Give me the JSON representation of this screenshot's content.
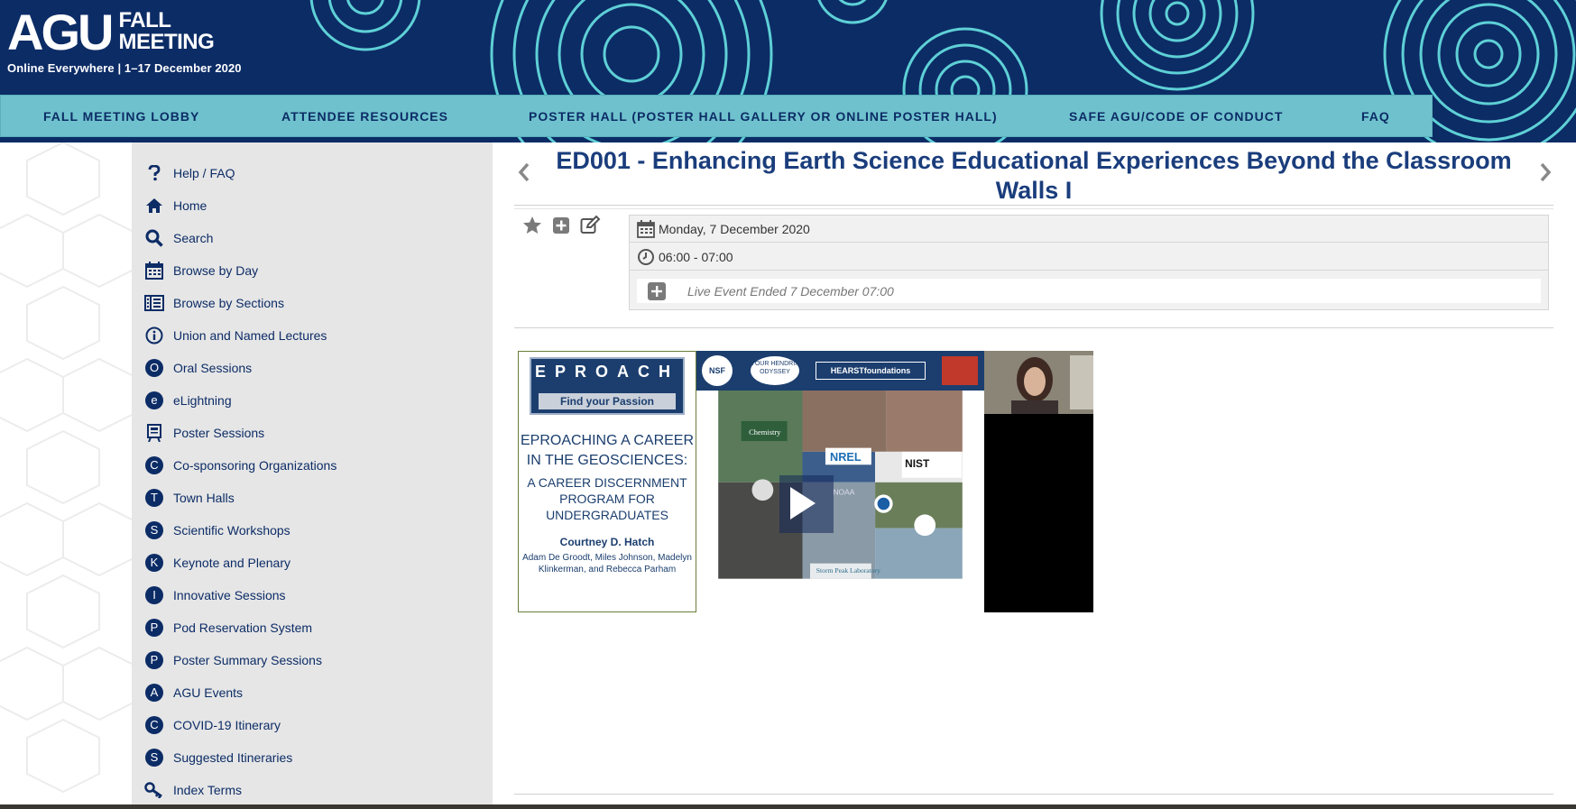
{
  "header": {
    "logo_agu": "AGU",
    "logo_line1": "FALL",
    "logo_line2": "MEETING",
    "tagline": "Online Everywhere  |  1–17 December 2020",
    "colors": {
      "banner": "#0c2c66",
      "nav": "#6fc2cd",
      "rings": "#5ed0d6"
    }
  },
  "topnav": [
    {
      "label": "FALL MEETING LOBBY"
    },
    {
      "label": "ATTENDEE RESOURCES"
    },
    {
      "label": "POSTER HALL (POSTER HALL GALLERY OR ONLINE POSTER HALL)"
    },
    {
      "label": "SAFE AGU/CODE OF CONDUCT"
    },
    {
      "label": "FAQ"
    }
  ],
  "sidebar": {
    "items": [
      {
        "label": "Help / FAQ",
        "icon": "question-icon"
      },
      {
        "label": "Home",
        "icon": "home-icon"
      },
      {
        "label": "Search",
        "icon": "search-icon"
      },
      {
        "label": "Browse by Day",
        "icon": "calendar-icon"
      },
      {
        "label": "Browse by Sections",
        "icon": "sections-icon"
      },
      {
        "label": "Union and Named Lectures",
        "icon": "info-icon"
      },
      {
        "label": "Oral Sessions",
        "icon": "letter-o-icon",
        "letter": "O"
      },
      {
        "label": "eLightning",
        "icon": "letter-e-icon",
        "letter": "e"
      },
      {
        "label": "Poster Sessions",
        "icon": "poster-icon"
      },
      {
        "label": "Co-sponsoring Organizations",
        "icon": "letter-c-icon",
        "letter": "C"
      },
      {
        "label": "Town Halls",
        "icon": "letter-t-icon",
        "letter": "T"
      },
      {
        "label": "Scientific Workshops",
        "icon": "letter-s-icon",
        "letter": "S"
      },
      {
        "label": "Keynote and Plenary",
        "icon": "letter-k-icon",
        "letter": "K"
      },
      {
        "label": "Innovative Sessions",
        "icon": "letter-i-icon",
        "letter": "I"
      },
      {
        "label": "Pod Reservation System",
        "icon": "letter-p-icon",
        "letter": "P"
      },
      {
        "label": "Poster Summary Sessions",
        "icon": "letter-p-icon",
        "letter": "P"
      },
      {
        "label": "AGU Events",
        "icon": "letter-a-icon",
        "letter": "A"
      },
      {
        "label": "COVID-19 Itinerary",
        "icon": "letter-c-icon",
        "letter": "C"
      },
      {
        "label": "Suggested Itineraries",
        "icon": "letter-s-icon",
        "letter": "S"
      },
      {
        "label": "Index Terms",
        "icon": "key-icon"
      }
    ]
  },
  "session": {
    "title": "ED001 - Enhancing Earth Science Educational Experiences Beyond the Classroom Walls I",
    "date": "Monday, 7 December 2020",
    "time": "06:00 - 07:00",
    "live_status": "Live Event Ended 7 December 07:00"
  },
  "video": {
    "slide_letters": "EPROACH",
    "slide_find": "Find your Passion",
    "slide_title": "EPROACHING A CAREER IN THE GEOSCIENCES:",
    "slide_subtitle": "A CAREER DISCERNMENT PROGRAM FOR UNDERGRADUATES",
    "slide_author": "Courtney D. Hatch",
    "slide_coauthors": "Adam De Groodt, Miles Johnson, Madelyn Klinkerman, and Rebecca Parham",
    "logos": [
      "NSF",
      "YOUR HENDRIX ODYSSEY",
      "HEARSTfoundations",
      "NREL",
      "NIST",
      "NOAA",
      "Storm Peak Laboratory",
      "Chemistry"
    ]
  }
}
